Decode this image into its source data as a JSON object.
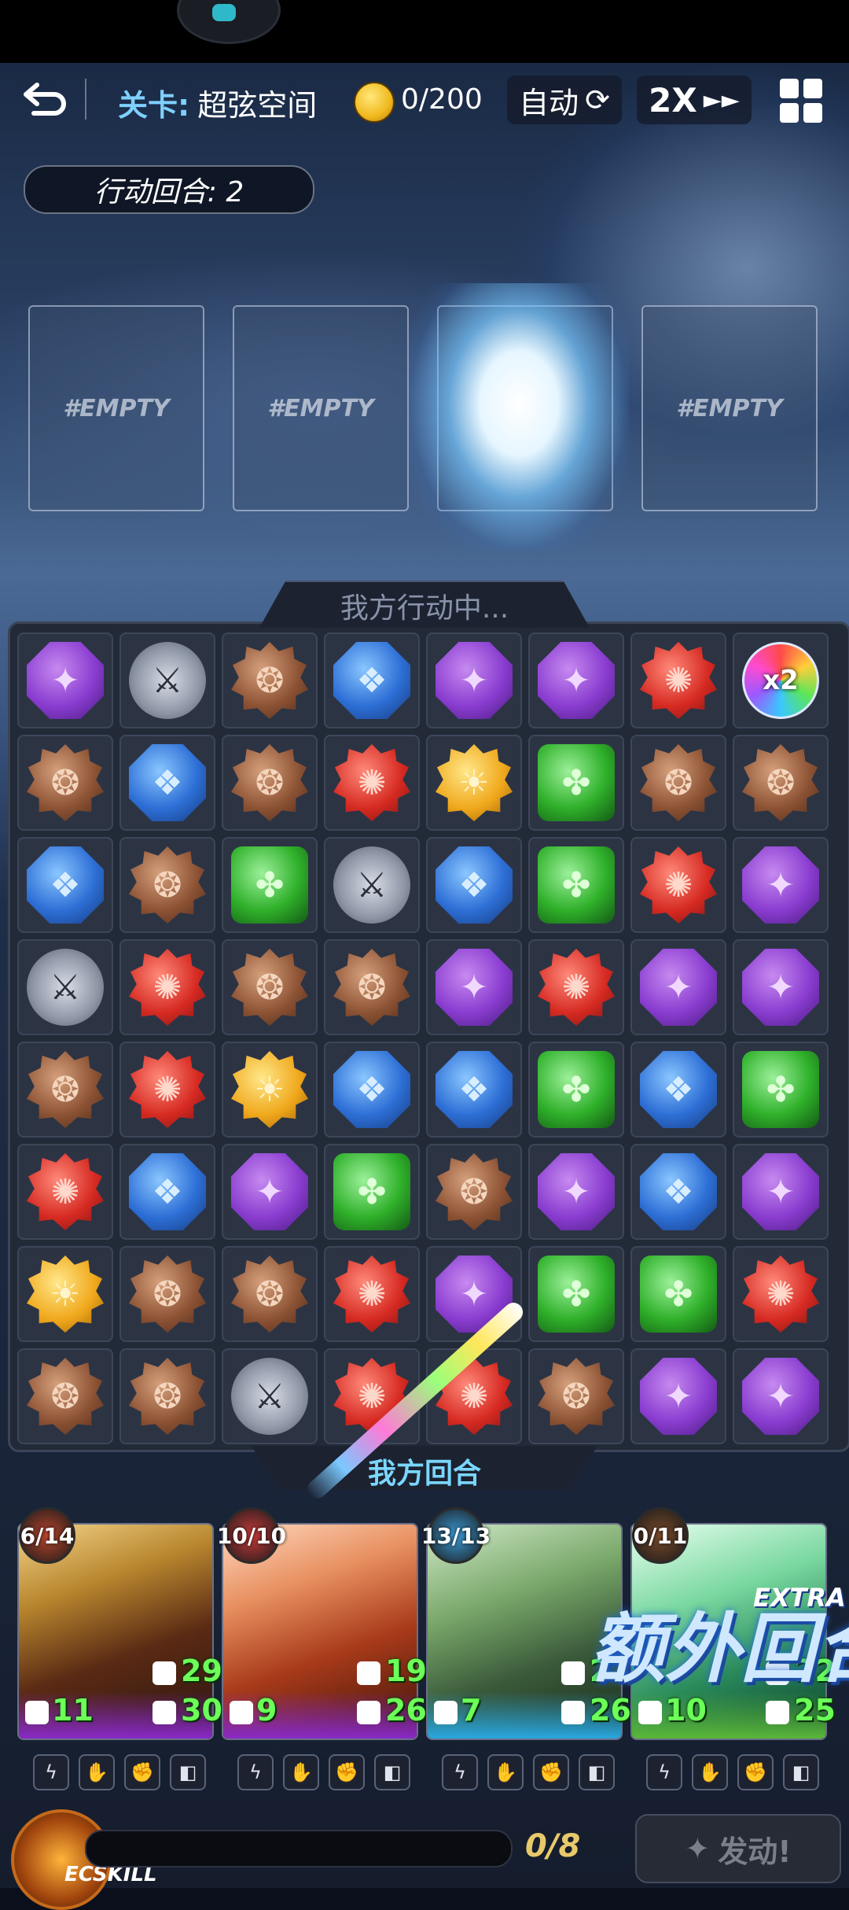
{
  "header": {
    "stage_label": "关卡:",
    "stage_name": "超弦空间",
    "coins": "0/200",
    "auto_label": "自动",
    "speed_label": "2X"
  },
  "round": "行动回合: 2",
  "slots": [
    "#EMPTY",
    "#EMPTY",
    "",
    "#EMPTY"
  ],
  "board": {
    "title": "我方行动中...",
    "bottom_label": "我方回合",
    "rows": [
      [
        "purple",
        "sword",
        "brown",
        "blue",
        "purple",
        "purple",
        "red",
        "rainbow"
      ],
      [
        "brown",
        "blue",
        "brown",
        "red",
        "yellow",
        "green",
        "brown",
        "brown"
      ],
      [
        "blue",
        "brown",
        "green",
        "sword",
        "blue",
        "green",
        "red",
        "purple"
      ],
      [
        "sword",
        "red",
        "brown",
        "brown",
        "purple",
        "red",
        "purple",
        "purple"
      ],
      [
        "brown",
        "red",
        "yellow",
        "blue",
        "blue",
        "green",
        "blue",
        "green"
      ],
      [
        "red",
        "blue",
        "purple",
        "green",
        "brown",
        "purple",
        "blue",
        "purple"
      ],
      [
        "yellow",
        "brown",
        "brown",
        "red",
        "purple",
        "green",
        "green",
        "red"
      ],
      [
        "brown",
        "brown",
        "sword",
        "red",
        "red",
        "brown",
        "purple",
        "purple"
      ]
    ],
    "rainbow_label": "x2"
  },
  "cards": [
    {
      "count": "6/14",
      "armor": "29",
      "attack": "11",
      "hp": "30",
      "badge_color": "#b8452c",
      "bar_color": "#8a2ac8"
    },
    {
      "count": "10/10",
      "armor": "19",
      "attack": "9",
      "hp": "26",
      "badge_color": "#c83a3a",
      "bar_color": "#8a2ac8"
    },
    {
      "count": "13/13",
      "armor": "21",
      "attack": "7",
      "hp": "26",
      "badge_color": "#3a9ad6",
      "bar_color": "#2aa8e0"
    },
    {
      "count": "0/11",
      "armor": "22",
      "attack": "10",
      "hp": "25",
      "badge_color": "#7a4a2a",
      "bar_color": "#5ab83a"
    }
  ],
  "extra_turn": {
    "word": "EXTRA",
    "text": "额外回合"
  },
  "footer": {
    "ecskill_label": "ECSKILL",
    "progress": "0/8",
    "skill_button": "发动!"
  }
}
